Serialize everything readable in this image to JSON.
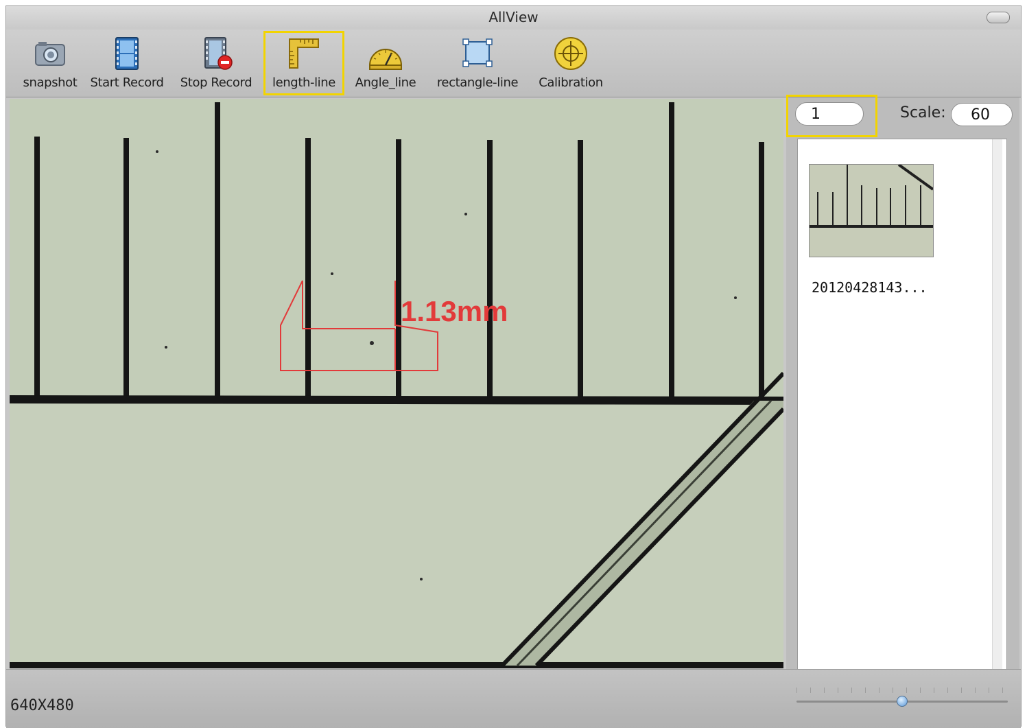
{
  "window": {
    "title": "AllView"
  },
  "toolbar": {
    "items": [
      {
        "label": "snapshot",
        "icon": "camera-icon"
      },
      {
        "label": "Start Record",
        "icon": "film-icon"
      },
      {
        "label": "Stop Record",
        "icon": "film-stop-icon"
      },
      {
        "label": "length-line",
        "icon": "ruler-icon",
        "selected": true
      },
      {
        "label": "Angle_line",
        "icon": "protractor-icon"
      },
      {
        "label": "rectangle-line",
        "icon": "rectangle-icon"
      },
      {
        "label": "Calibration",
        "icon": "crosshair-icon"
      }
    ]
  },
  "sidebar": {
    "input_value": "1",
    "scale_label": "Scale:",
    "scale_value": "60",
    "thumbnails": [
      {
        "name": "20120428143..."
      }
    ]
  },
  "viewer": {
    "measurement": "1.13mm"
  },
  "status": {
    "resolution": "640X480",
    "zoom_level": 0.5
  },
  "colors": {
    "highlight": "#f2d400",
    "measurement": "#e23a3a",
    "specimen": "#c7d0bd"
  }
}
